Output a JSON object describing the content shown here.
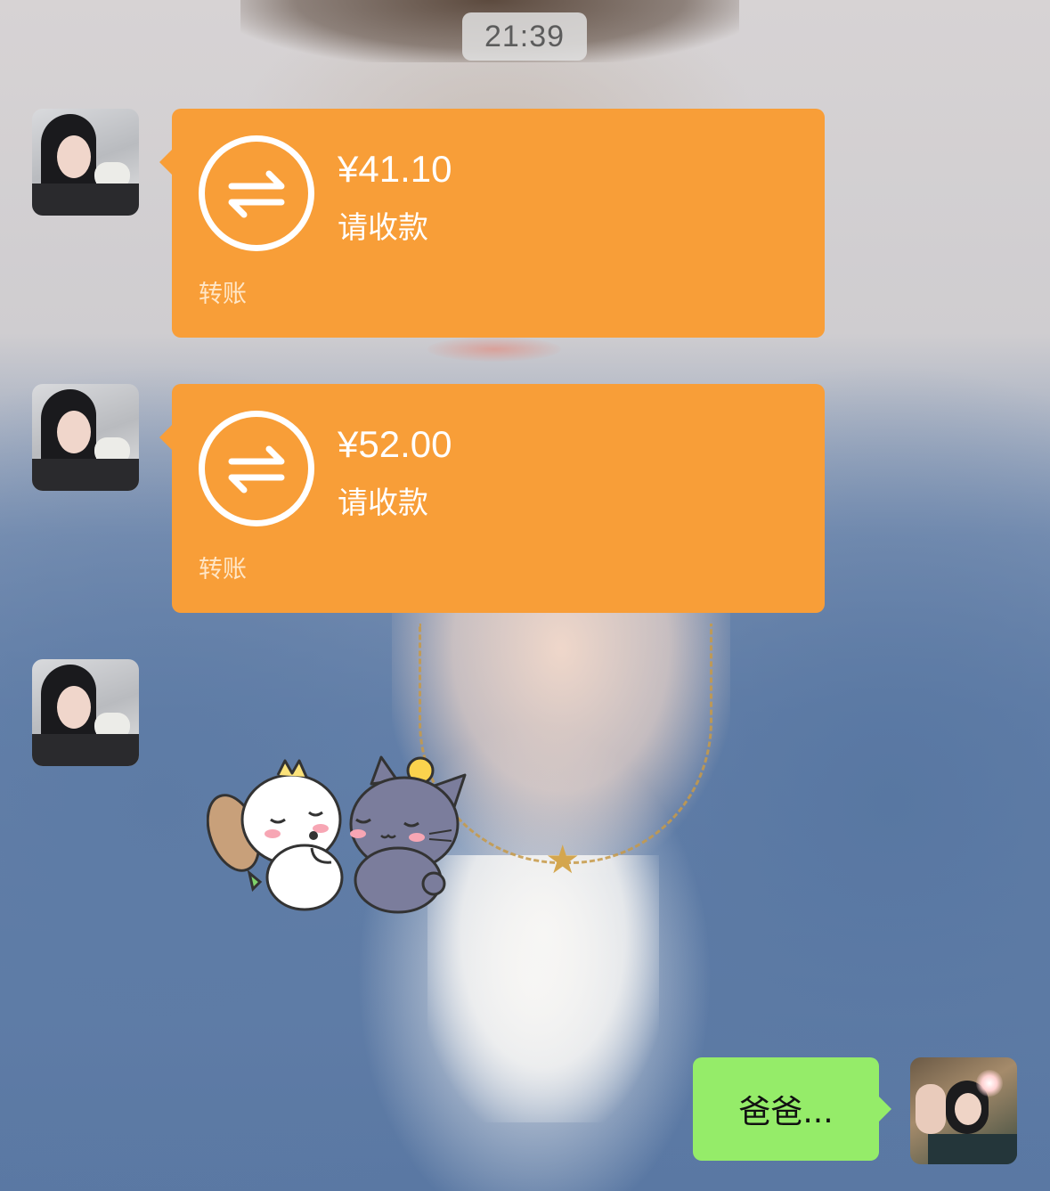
{
  "header": {
    "time": "21:39"
  },
  "messages": [
    {
      "type": "transfer",
      "sender": "other",
      "amount": "¥41.10",
      "status": "请收款",
      "label": "转账"
    },
    {
      "type": "transfer",
      "sender": "other",
      "amount": "¥52.00",
      "status": "请收款",
      "label": "转账"
    },
    {
      "type": "sticker",
      "sender": "other",
      "icon": "hugging-dog-cat-sticker"
    },
    {
      "type": "text",
      "sender": "me",
      "text": "爸爸..."
    }
  ],
  "colors": {
    "transfer_bubble": "#f89e38",
    "my_bubble": "#95ec69"
  }
}
